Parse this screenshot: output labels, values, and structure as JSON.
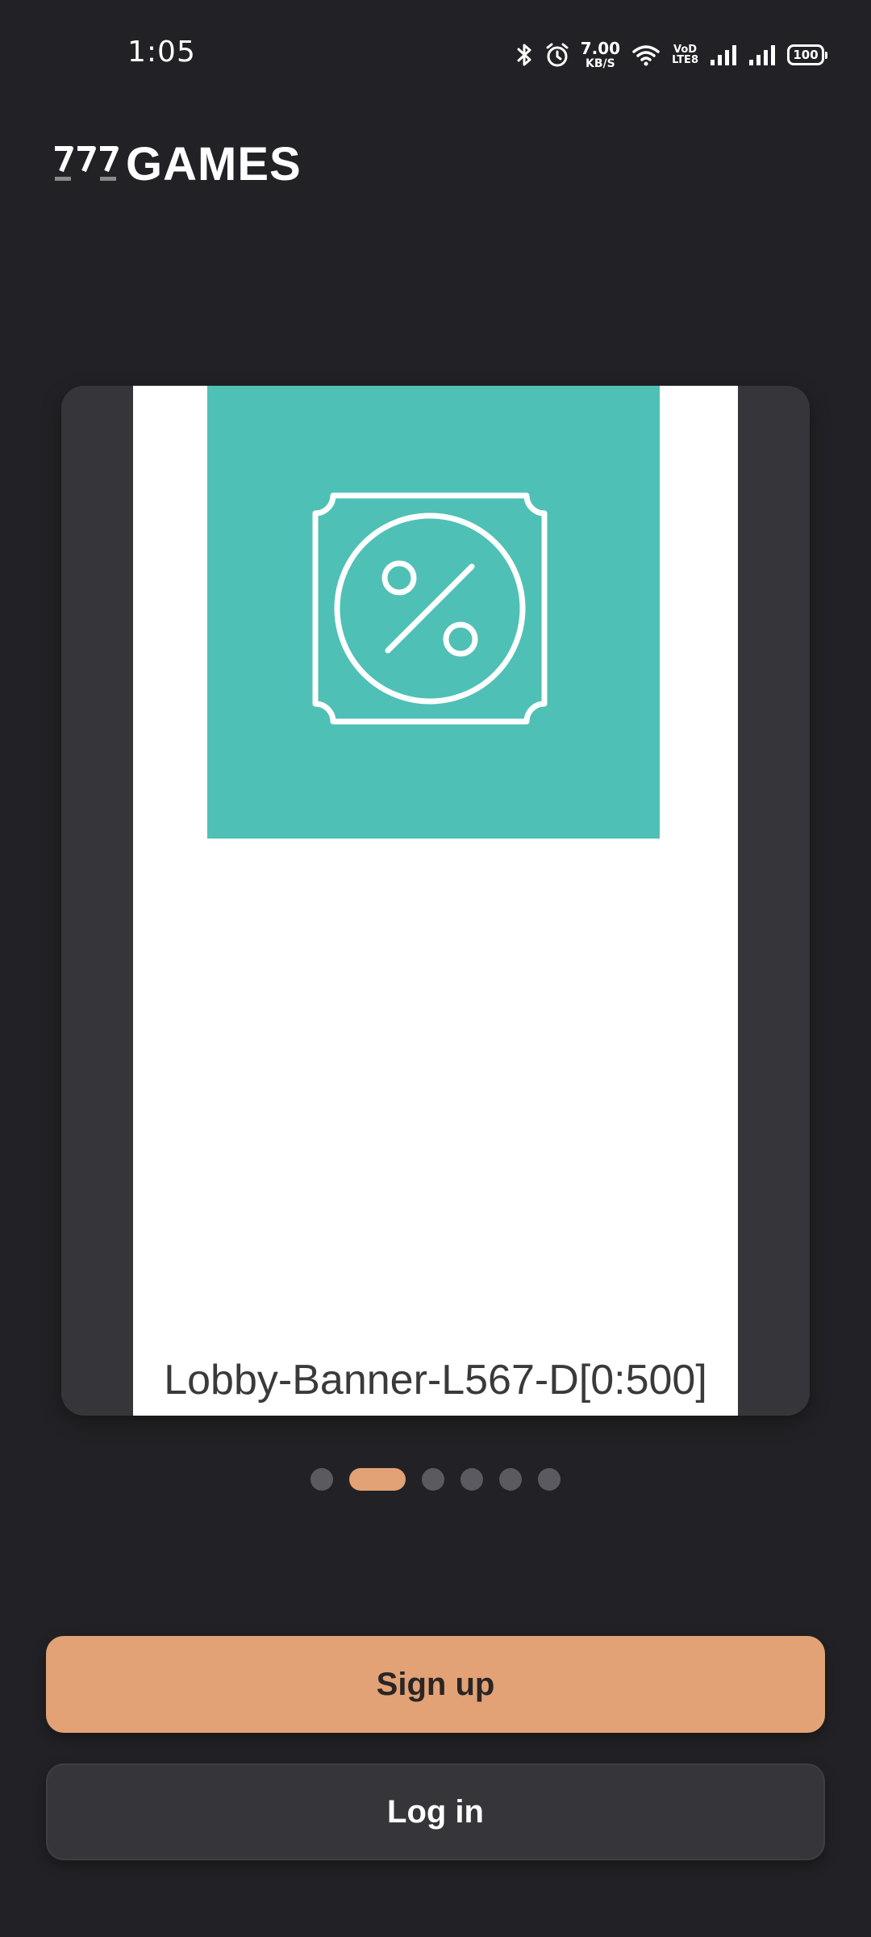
{
  "status_bar": {
    "time": "1:05",
    "net_speed_value": "7.00",
    "net_speed_unit": "KB/S",
    "volte_top": "VoD",
    "volte_bottom": "LTE8",
    "battery": "100",
    "icons": [
      "bluetooth-icon",
      "alarm-icon",
      "wifi-icon",
      "volte-icon",
      "signal-icon",
      "signal-icon",
      "battery-icon"
    ]
  },
  "header": {
    "logo_text": "GAMES",
    "logo_mark": "777"
  },
  "carousel": {
    "banner_caption": "Lobby-Banner-L567-D[0:500]",
    "banner_icon": "discount-ticket-icon",
    "banner_color": "#4fc0b6",
    "page_count": 6,
    "active_index": 1
  },
  "actions": {
    "signup_label": "Sign up",
    "login_label": "Log in"
  },
  "colors": {
    "background": "#222226",
    "accent": "#e2a275",
    "card": "#35353a"
  }
}
